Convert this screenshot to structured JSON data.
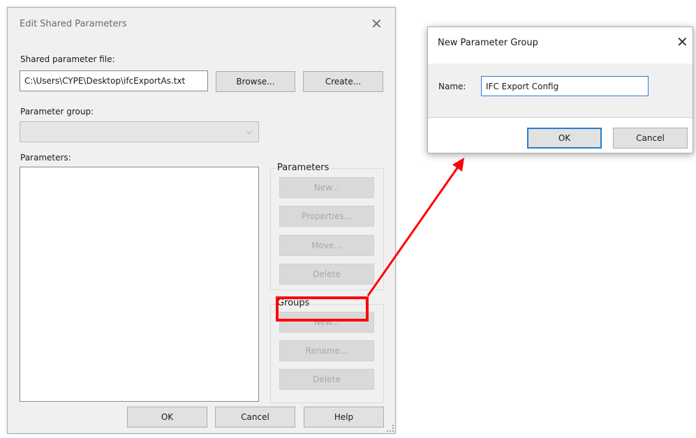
{
  "main_dialog": {
    "title": "Edit Shared Parameters",
    "shared_param_file_label": "Shared parameter file:",
    "file_path": "C:\\Users\\CYPE\\Desktop\\ifcExportAs.txt",
    "browse_label": "Browse...",
    "create_label": "Create...",
    "param_group_label": "Parameter group:",
    "param_group_value": "",
    "parameters_label": "Parameters:",
    "parameters_box": {
      "title": "Parameters",
      "buttons": [
        "New...",
        "Properties...",
        "Move...",
        "Delete"
      ]
    },
    "groups_box": {
      "title": "Groups",
      "buttons": [
        "New...",
        "Rename...",
        "Delete"
      ]
    },
    "ok_label": "OK",
    "cancel_label": "Cancel",
    "help_label": "Help"
  },
  "new_param_group_dialog": {
    "title": "New Parameter Group",
    "name_label": "Name:",
    "name_value": "IFC Export Config",
    "ok_label": "OK",
    "cancel_label": "Cancel"
  },
  "annotation": {
    "highlight_color": "#ff0000",
    "arrow_color": "#ff0000"
  }
}
